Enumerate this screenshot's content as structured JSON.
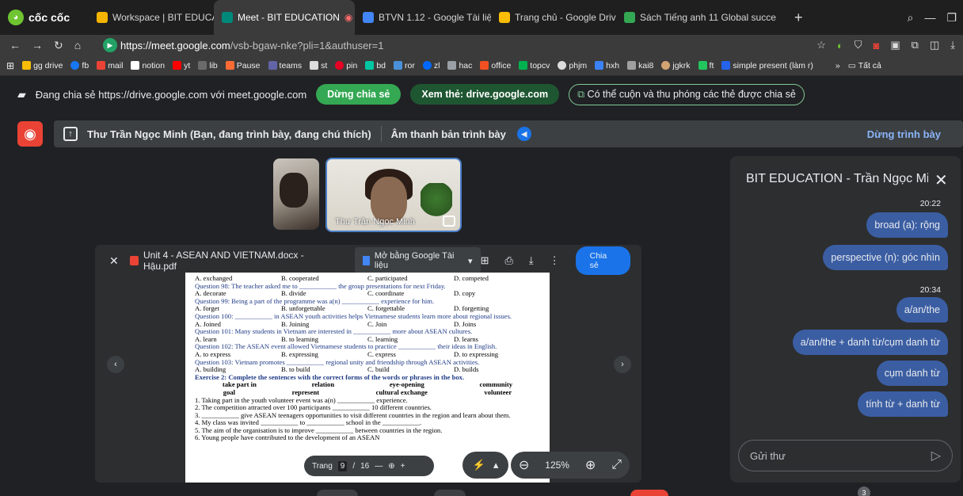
{
  "browser": {
    "brand": "cốc cốc",
    "tabs": [
      {
        "title": "Workspace | BIT EDUCATION",
        "color": "#f4b400"
      },
      {
        "title": "Meet - BIT EDUCATION",
        "color": "#00897b",
        "active": true
      },
      {
        "title": "BTVN 1.12 - Google Tài liệu",
        "color": "#4285f4"
      },
      {
        "title": "Trang chủ - Google Drive",
        "color": "#fbbc04"
      },
      {
        "title": "Sách Tiếng anh 11 Global succe",
        "color": "#34a853"
      }
    ],
    "new_tab": "+",
    "url_scheme": "https://",
    "url_host": "meet.google.com",
    "url_path": "/vsb-bgaw-nke?pli=1&authuser=1",
    "bookmarks": [
      "gg drive",
      "fb",
      "mail",
      "notion",
      "yt",
      "lib",
      "Pause",
      "teams",
      "st",
      "pin",
      "bd",
      "ror",
      "zl",
      "hac",
      "office",
      "topcv",
      "phjm",
      "hxh",
      "kai8",
      "jgkrk",
      "ft",
      "simple present (làm r)"
    ],
    "bookmarks_more": "»",
    "bookmarks_all": "Tất cả"
  },
  "sharebar": {
    "text": "Đang chia sẻ https://drive.google.com với meet.google.com",
    "stop": "Dừng chia sẻ",
    "view": "Xem thẻ: drive.google.com",
    "scroll": "Có thể cuộn và thu phóng các thẻ được chia sẻ"
  },
  "presenting": {
    "who": "Thư Trần Ngọc Minh (Bạn, đang trình bày, đang chú thích)",
    "audio": "Âm thanh bản trình bày",
    "stop": "Dừng trình bày"
  },
  "tiles": {
    "name": "Thư Trần Ngọc Minh"
  },
  "pdf": {
    "filename": "Unit 4 - ASEAN AND VIETNAM.docx - Hậu.pdf",
    "open_with": "Mở bằng Google Tài liệu",
    "share": "Chia sẻ",
    "page_label": "Trang",
    "page_num": "9",
    "page_sep": "/",
    "page_total": "16",
    "zoom": "125%",
    "lines": {
      "a97": [
        "A. exchanged",
        "B. cooperated",
        "C. participated",
        "D. competed"
      ],
      "q98": "Question 98: The teacher asked me to ___________ the group presentations for next Friday.",
      "a98": [
        "A. decorate",
        "B. divide",
        "C. coordinate",
        "D. copy"
      ],
      "q99": "Question 99: Being a part of the programme was a(n) ___________ experience for him.",
      "a99": [
        "A. forget",
        "B. unforgettable",
        "C. forgettable",
        "D. forgetting"
      ],
      "q100": "Question 100: ___________ in ASEAN youth activities helps Vietnamese students learn more about regional issues.",
      "a100": [
        "A. Joined",
        "B. Joining",
        "C. Join",
        "D. Joins"
      ],
      "q101": "Question 101: Many students in Vietnam are interested in ___________ more about ASEAN cultures.",
      "a101": [
        "A. learn",
        "B. to learning",
        "C. learning",
        "D. learns"
      ],
      "q102": "Question 102: The ASEAN event allowed Vietnamese students to practice ___________ their ideas in English.",
      "a102": [
        "A. to express",
        "B. expressing",
        "C. express",
        "D. to expressing"
      ],
      "q103": "Question 103: Vietnam promotes ___________ regional unity and friendship through ASEAN activities.",
      "a103": [
        "A. building",
        "B. to build",
        "C. build",
        "D. builds"
      ],
      "ex2": "Exercise 2: Complete the sentences with the correct forms of the words or phrases in the box.",
      "box1": [
        "take part in",
        "relation",
        "eye-opening",
        "community"
      ],
      "box2": [
        "goal",
        "represent",
        "cultural exchange",
        "volunteer"
      ],
      "s1": "1. Taking part in the youth volunteer event was a(n) ___________ experience.",
      "s2": "2. The competition attracted over 100 participants ___________ 10 different countries.",
      "s3": "3. ___________ give ASEAN teenagers opportunities to visit different countries in the region and learn about them.",
      "s4": "4. My class was invited ___________ to ___________ school in the ___________.",
      "s5": "5. The aim of the organisation is to improve ___________ between countries in the region.",
      "s6": "6. Young people have contributed to the development of an ASEAN"
    }
  },
  "chat": {
    "title": "BIT EDUCATION - Trần Ngọc Min...",
    "messages": [
      {
        "time": "20:22",
        "text": "broad (a): rộng"
      },
      {
        "time": "",
        "text": "perspective (n): góc nhìn"
      },
      {
        "time": "20:34",
        "text": "a/an/the"
      },
      {
        "time": "",
        "text": "a/an/the + danh từ/cụm danh từ"
      },
      {
        "time": "",
        "text": "cụm danh từ"
      },
      {
        "time": "",
        "text": "tính từ + danh từ"
      }
    ],
    "input_placeholder": "Gửi thư",
    "badge": "3"
  }
}
